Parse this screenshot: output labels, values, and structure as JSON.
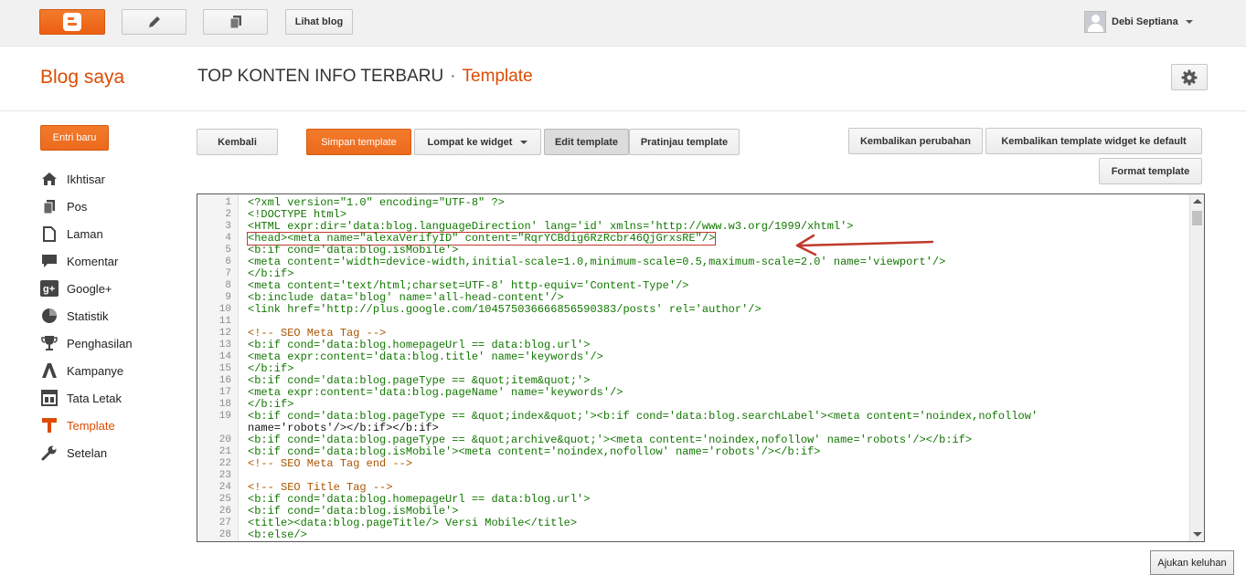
{
  "topbar": {
    "view_blog_label": "Lihat blog",
    "user_name": "Debi Septiana",
    "icons": [
      "blogger-logo-icon",
      "pencil-icon",
      "pages-icon",
      "avatar",
      "chevron-down-icon"
    ]
  },
  "header": {
    "section_title": "Blog saya",
    "blog_name": "TOP KONTEN INFO TERBARU",
    "separator": "·",
    "page_name": "Template"
  },
  "sidebar": {
    "new_post_label": "Entri baru",
    "items": [
      {
        "label": "Ikhtisar",
        "icon": "home-icon"
      },
      {
        "label": "Pos",
        "icon": "posts-icon"
      },
      {
        "label": "Laman",
        "icon": "page-icon"
      },
      {
        "label": "Komentar",
        "icon": "comment-icon"
      },
      {
        "label": "Google+",
        "icon": "google-plus-icon"
      },
      {
        "label": "Statistik",
        "icon": "pie-chart-icon"
      },
      {
        "label": "Penghasilan",
        "icon": "trophy-icon"
      },
      {
        "label": "Kampanye",
        "icon": "adwords-icon"
      },
      {
        "label": "Tata Letak",
        "icon": "layout-icon"
      },
      {
        "label": "Template",
        "icon": "template-icon",
        "active": true
      },
      {
        "label": "Setelan",
        "icon": "wrench-icon"
      }
    ]
  },
  "toolbar": {
    "back": "Kembali",
    "save": "Simpan template",
    "jump_to_widget": "Lompat ke widget",
    "edit": "Edit template",
    "preview": "Pratinjau template",
    "revert_changes": "Kembalikan perubahan",
    "revert_widgets": "Kembalikan template widget ke default",
    "format": "Format template"
  },
  "editor": {
    "lines": [
      {
        "n": "1",
        "t": "<?xml version=\"1.0\" encoding=\"UTF-8\" ?>"
      },
      {
        "n": "2",
        "t": "<!DOCTYPE html>"
      },
      {
        "n": "3",
        "t": "<HTML expr:dir='data:blog.languageDirection' lang='id' xmlns='http://www.w3.org/1999/xhtml'>"
      },
      {
        "n": "4",
        "t": "<head><meta name=\"alexaVerifyID\" content=\"RqrYCBdig6RzRcbr46QjGrxsRE\"/>"
      },
      {
        "n": "5",
        "t": "<b:if cond='data:blog.isMobile'>"
      },
      {
        "n": "6",
        "t": "<meta content='width=device-width,initial-scale=1.0,minimum-scale=0.5,maximum-scale=2.0' name='viewport'/>"
      },
      {
        "n": "7",
        "t": "</b:if>"
      },
      {
        "n": "8",
        "t": "<meta content='text/html;charset=UTF-8' http-equiv='Content-Type'/>"
      },
      {
        "n": "9",
        "t": "<b:include data='blog' name='all-head-content'/>"
      },
      {
        "n": "10",
        "t": "<link href='http://plus.google.com/104575036666856590383/posts' rel='author'/>"
      },
      {
        "n": "11",
        "t": ""
      },
      {
        "n": "12",
        "t": "<!-- SEO Meta Tag -->"
      },
      {
        "n": "13",
        "t": "<b:if cond='data:blog.homepageUrl == data:blog.url'>"
      },
      {
        "n": "14",
        "t": "<meta expr:content='data:blog.title' name='keywords'/>"
      },
      {
        "n": "15",
        "t": "</b:if>"
      },
      {
        "n": "16",
        "t": "<b:if cond='data:blog.pageType == &quot;item&quot;'>"
      },
      {
        "n": "17",
        "t": "<meta expr:content='data:blog.pageName' name='keywords'/>"
      },
      {
        "n": "18",
        "t": "</b:if>"
      },
      {
        "n": "19",
        "t": "<b:if cond='data:blog.pageType == &quot;index&quot;'><b:if cond='data:blog.searchLabel'><meta content='noindex,nofollow'"
      },
      {
        "n": "",
        "t": "name='robots'/></b:if></b:if>"
      },
      {
        "n": "20",
        "t": "<b:if cond='data:blog.pageType == &quot;archive&quot;'><meta content='noindex,nofollow' name='robots'/></b:if>"
      },
      {
        "n": "21",
        "t": "<b:if cond='data:blog.isMobile'><meta content='noindex,nofollow' name='robots'/></b:if>"
      },
      {
        "n": "22",
        "t": "<!-- SEO Meta Tag end -->"
      },
      {
        "n": "23",
        "t": ""
      },
      {
        "n": "24",
        "t": "<!-- SEO Title Tag -->"
      },
      {
        "n": "25",
        "t": "<b:if cond='data:blog.homepageUrl == data:blog.url'>"
      },
      {
        "n": "26",
        "t": "<b:if cond='data:blog.isMobile'>"
      },
      {
        "n": "27",
        "t": "<title><data:blog.pageTitle/> Versi Mobile</title>"
      },
      {
        "n": "28",
        "t": "<b:else/>"
      }
    ]
  },
  "feedback_label": "Ajukan keluhan",
  "colors": {
    "accent": "#dd4b00",
    "button_orange": "#f06a1e",
    "annotation_red": "#c0392b"
  }
}
